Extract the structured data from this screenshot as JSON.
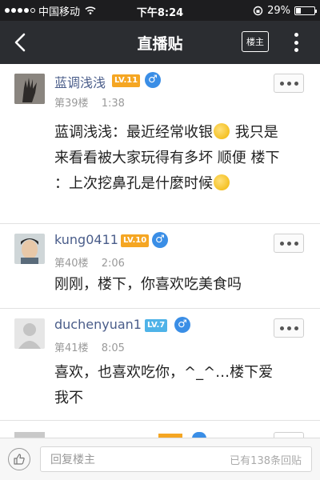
{
  "status_bar": {
    "carrier": "中国移动",
    "time": "下午8:24",
    "battery": "29%",
    "battery_level": 0.29
  },
  "header": {
    "title": "直播贴",
    "owner_label": "楼主"
  },
  "posts": [
    {
      "username": "蓝调浅浅",
      "level": "LV.11",
      "floor": "第39楼",
      "time": "1:38",
      "lines": [
        "蓝调浅浅：最近经常收银",
        " 我只是",
        "来看看被大家玩得有多坏 顺便 楼下",
        "：上次挖鼻孔是什麼时候"
      ],
      "level_color": "#f5a623"
    },
    {
      "username": "kung0411",
      "level": "LV.10",
      "floor": "第40楼",
      "time": "2:06",
      "lines": [
        "刚刚，楼下，你喜欢吃美食吗"
      ],
      "level_color": "#f5a623"
    },
    {
      "username": "duchenyuan1",
      "level": "LV.7",
      "floor": "第41楼",
      "time": "8:05",
      "lines": [
        "喜欢，也喜欢吃你，^_^…楼下爱",
        "我不"
      ],
      "level_color": "#4fb3e8"
    }
  ],
  "bottom_bar": {
    "reply_placeholder": "回复楼主",
    "reply_count": "已有138条回贴"
  },
  "colors": {
    "male_badge": "#3a8ee6",
    "username": "#4a5d8a"
  },
  "icons": [
    "back-arrow-icon",
    "more-vertical-icon",
    "more-horizontal-icon",
    "male-icon",
    "thumbs-up-icon",
    "wifi-icon",
    "battery-icon",
    "signal-icon"
  ]
}
